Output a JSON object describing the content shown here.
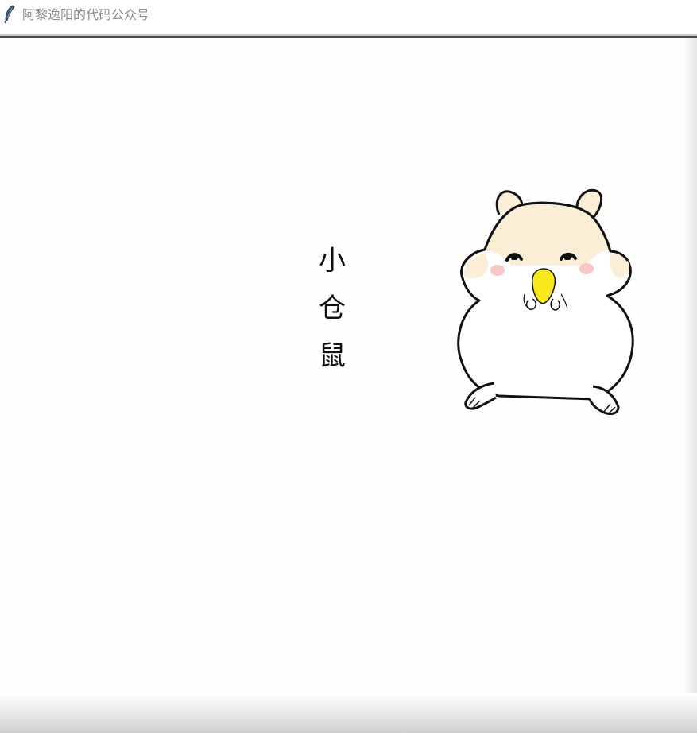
{
  "window": {
    "title": "阿黎逸阳的代码公众号",
    "icon": "feather-icon"
  },
  "canvas": {
    "text_chars": [
      "小",
      "仓",
      "鼠"
    ],
    "illustration": "hamster-illustration",
    "colors": {
      "background": "#fffefd",
      "fur_top": "#fbeed7",
      "body": "#ffffff",
      "outline": "#111111",
      "cheek": "#f7c6c6",
      "seed": "#f7e81c"
    }
  }
}
